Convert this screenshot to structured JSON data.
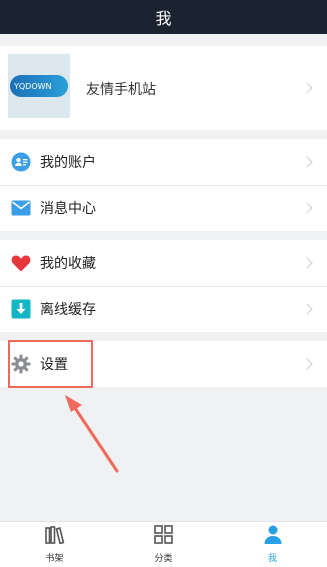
{
  "header": {
    "title": "我"
  },
  "profile": {
    "name": "友情手机站",
    "logo_text": "YQDOWN"
  },
  "sections": [
    {
      "items": [
        {
          "label": "我的账户",
          "icon": "account-icon"
        },
        {
          "label": "消息中心",
          "icon": "mail-icon"
        }
      ]
    },
    {
      "items": [
        {
          "label": "我的收藏",
          "icon": "heart-icon"
        },
        {
          "label": "离线缓存",
          "icon": "download-icon"
        }
      ]
    },
    {
      "items": [
        {
          "label": "设置",
          "icon": "gear-icon"
        }
      ]
    }
  ],
  "tabs": [
    {
      "label": "书架",
      "icon": "bookshelf-icon",
      "active": false
    },
    {
      "label": "分类",
      "icon": "category-icon",
      "active": false
    },
    {
      "label": "我",
      "icon": "person-icon",
      "active": true
    }
  ],
  "colors": {
    "header_bg": "#1b2230",
    "accent": "#2aa0e4",
    "highlight": "#ef6a5b"
  }
}
